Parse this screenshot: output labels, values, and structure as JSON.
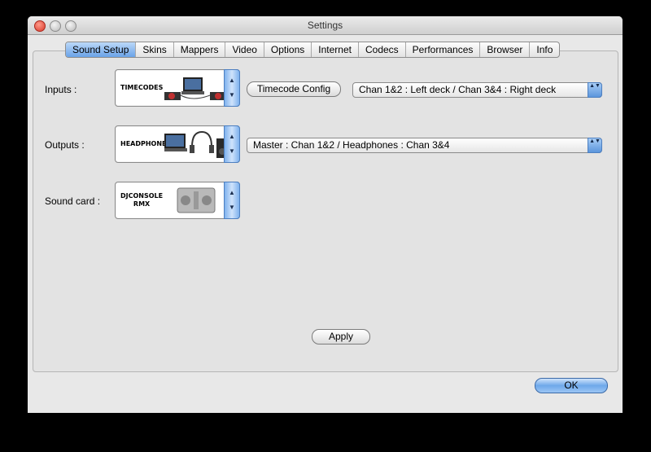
{
  "window": {
    "title": "Settings"
  },
  "tabs": [
    {
      "label": "Sound Setup"
    },
    {
      "label": "Skins"
    },
    {
      "label": "Mappers"
    },
    {
      "label": "Video"
    },
    {
      "label": "Options"
    },
    {
      "label": "Internet"
    },
    {
      "label": "Codecs"
    },
    {
      "label": "Performances"
    },
    {
      "label": "Browser"
    },
    {
      "label": "Info"
    }
  ],
  "active_tab": "Sound Setup",
  "inputs": {
    "label": "Inputs :",
    "device_name": "TIMECODES",
    "config_button": "Timecode Config",
    "routing": "Chan 1&2 : Left deck / Chan 3&4 : Right deck"
  },
  "outputs": {
    "label": "Outputs :",
    "device_name": "HEADPHONES",
    "routing": "Master : Chan 1&2 / Headphones : Chan 3&4"
  },
  "soundcard": {
    "label": "Sound card :",
    "device_line1": "DJCONSOLE",
    "device_line2": "RMX"
  },
  "apply_label": "Apply",
  "ok_label": "OK",
  "colors": {
    "accent": "#6aa3e8",
    "panel": "#e3e3e3"
  },
  "icons": {
    "stepper_up": "▲",
    "stepper_down": "▼",
    "select_arrows": "▲▼"
  }
}
